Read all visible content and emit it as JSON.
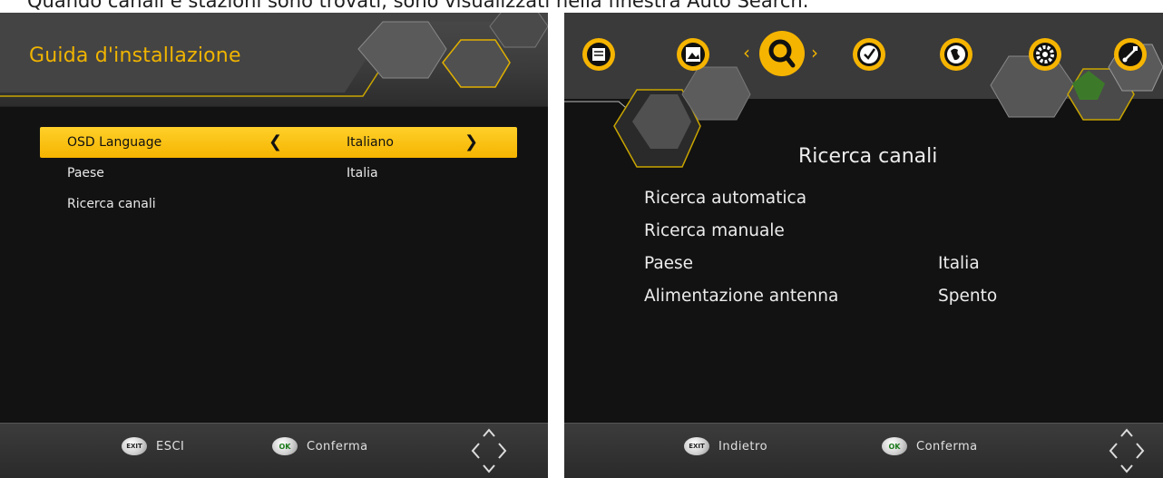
{
  "caption": "Quando canali e stazioni sono trovati, sono visualizzati nella finestra Auto Search.",
  "left_screen": {
    "title": "Guida d'installazione",
    "rows": [
      {
        "label": "OSD Language",
        "value": "Italiano",
        "selected": true
      },
      {
        "label": "Paese",
        "value": "Italia",
        "selected": false
      },
      {
        "label": "Ricerca canali",
        "value": "",
        "selected": false
      }
    ],
    "footer": {
      "exit_badge": "EXIT",
      "exit_label": "ESCI",
      "ok_badge": "OK",
      "ok_label": "Conferma"
    }
  },
  "right_screen": {
    "nav_icons": [
      "info-icon",
      "media-icon",
      "search-icon",
      "clock-icon",
      "globe-icon",
      "gear-icon",
      "usb-icon"
    ],
    "selected_nav": "search-icon",
    "title": "Ricerca canali",
    "rows": [
      {
        "label": "Ricerca automatica",
        "value": ""
      },
      {
        "label": "Ricerca manuale",
        "value": ""
      },
      {
        "label": "Paese",
        "value": "Italia"
      },
      {
        "label": "Alimentazione antenna",
        "value": "Spento"
      }
    ],
    "footer": {
      "exit_badge": "EXIT",
      "exit_label": "Indietro",
      "ok_badge": "OK",
      "ok_label": "Conferma"
    }
  },
  "colors": {
    "accent": "#f5b400",
    "background": "#121212",
    "header": "#3b3b3b",
    "text": "#ececec"
  }
}
